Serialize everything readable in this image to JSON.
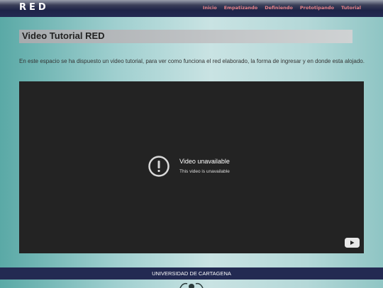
{
  "header": {
    "brand": "RED",
    "nav": [
      "Inicio",
      "Empatizando",
      "Definiendo",
      "Prototipando",
      "Tutorial"
    ]
  },
  "main": {
    "title": "Video Tutorial RED",
    "description": "En este espacio se ha dispuesto un video tutorial, para ver como funciona el red elaborado, la forma de ingresar y en donde esta alojado."
  },
  "video": {
    "status_title": "Video unavailable",
    "status_message": "This video is unavailable",
    "icons": [
      "alert-icon",
      "youtube-logo-icon"
    ]
  },
  "footer": {
    "text": "UNIVERSIDAD DE CARTAGENA"
  },
  "colors": {
    "header_bg": "#232a52",
    "nav_link": "#e8838a",
    "player_bg": "#232323",
    "footer_bg": "#232a52"
  }
}
